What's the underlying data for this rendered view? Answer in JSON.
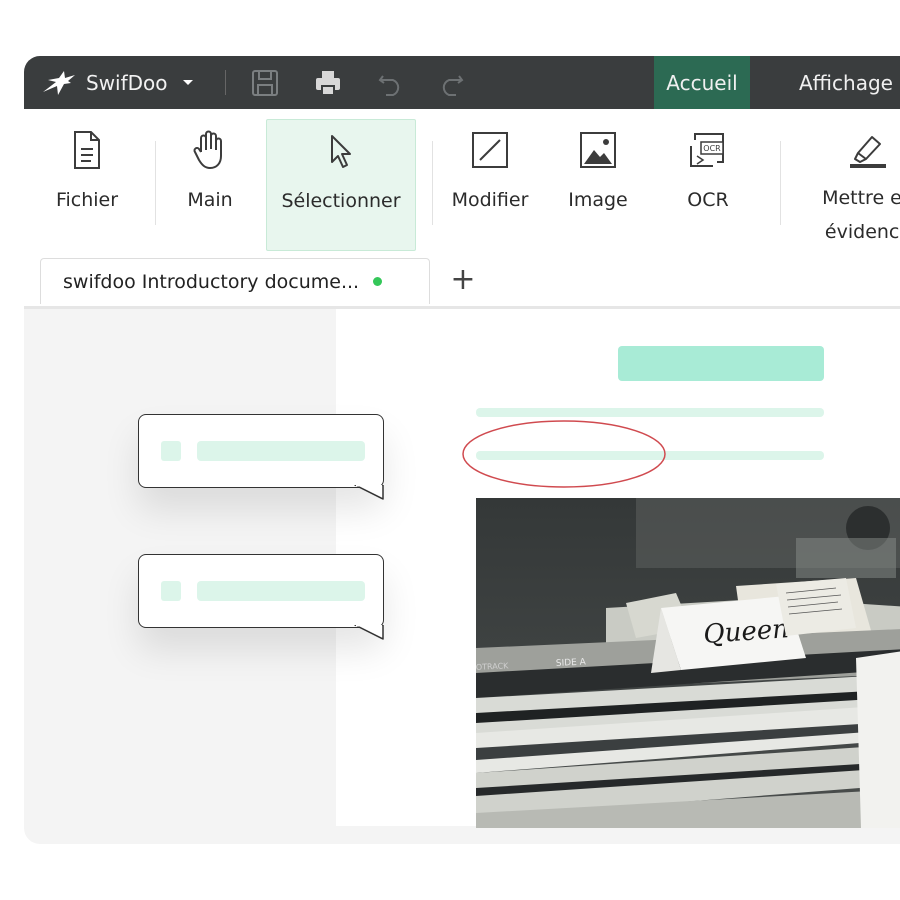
{
  "app": {
    "name": "SwifDoo"
  },
  "menu": {
    "tabs": [
      {
        "label": "Accueil",
        "active": true
      },
      {
        "label": "Affichage",
        "active": false
      }
    ]
  },
  "ribbon": {
    "buttons": [
      {
        "label": "Fichier",
        "icon": "file-icon"
      },
      {
        "label": "Main",
        "icon": "hand-icon"
      },
      {
        "label": "Sélectionner",
        "icon": "cursor-icon",
        "active": true
      },
      {
        "label": "Modifier",
        "icon": "edit-icon"
      },
      {
        "label": "Image",
        "icon": "image-icon"
      },
      {
        "label": "OCR",
        "icon": "ocr-icon"
      },
      {
        "label": "Mettre en\névidence",
        "icon": "highlighter-icon"
      }
    ]
  },
  "tabs": {
    "document": {
      "title": "swifdoo Introductory docume...",
      "status_color": "#34c759"
    },
    "new_tab": "+"
  },
  "photo": {
    "card_text": "Queen",
    "divider_text": "SIDE A",
    "track_text": "OTRACK"
  },
  "colors": {
    "accent": "#2c6a53",
    "titlebar": "#3a3d3e",
    "mint": "#a8ebd6",
    "mint_light": "#dcf5ea",
    "annotation": "#d04a4f"
  }
}
